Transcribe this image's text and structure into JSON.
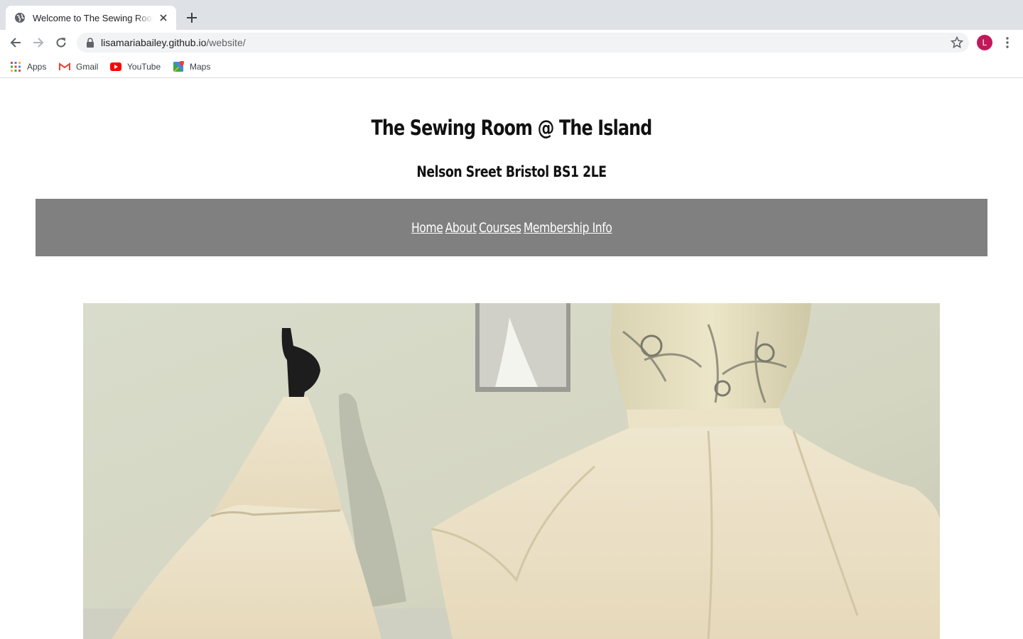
{
  "browser": {
    "tab": {
      "title": "Welcome to The Sewing Room @ The Island"
    },
    "url": {
      "host": "lisamariabailey.github.io",
      "path": "/website/"
    },
    "profile_initial": "L",
    "bookmarks": [
      {
        "label": "Apps",
        "icon": "apps-grid-icon"
      },
      {
        "label": "Gmail",
        "icon": "gmail-icon"
      },
      {
        "label": "YouTube",
        "icon": "youtube-icon"
      },
      {
        "label": "Maps",
        "icon": "maps-icon"
      }
    ],
    "colors": {
      "tabstrip": "#dee1e6",
      "omnibox": "#f1f3f4",
      "avatar": "#c2185b"
    }
  },
  "site": {
    "title": "The Sewing Room @ The Island",
    "address": "Nelson Sreet Bristol BS1 2LE",
    "nav": {
      "home": "Home",
      "about": "About",
      "courses": "Courses",
      "membership": "Membership Info"
    },
    "navbar_color": "#808080",
    "hero_image": "photo of two cream calico dress forms with flared skirts against a pale wall"
  }
}
